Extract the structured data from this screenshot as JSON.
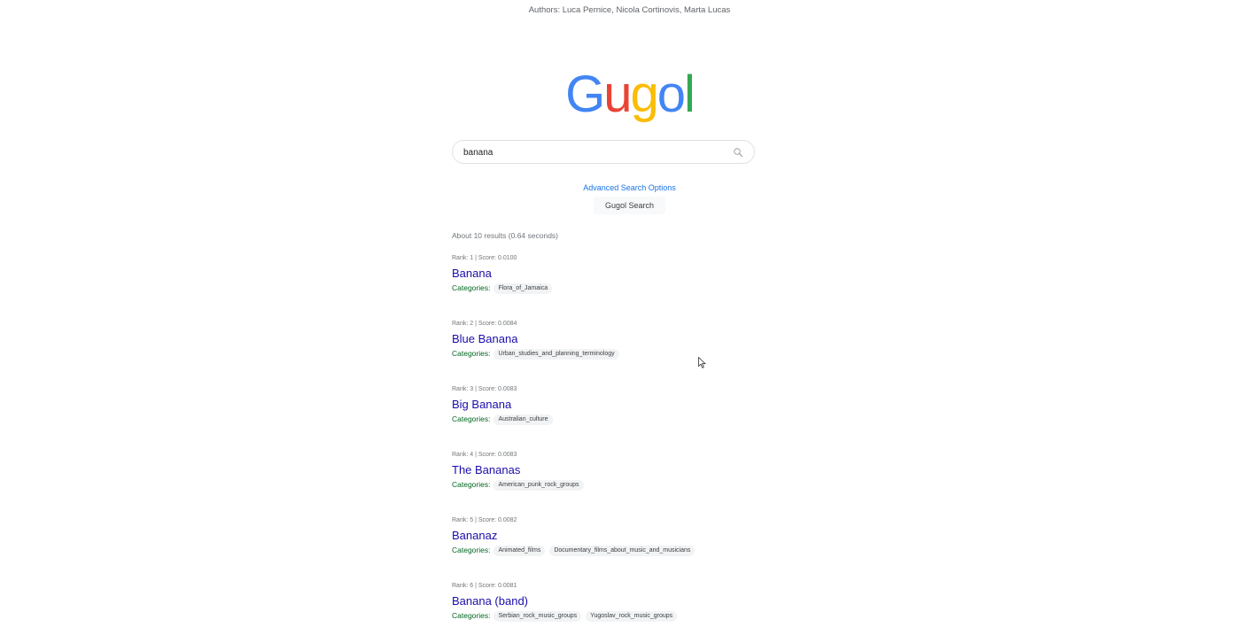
{
  "authors": "Authors: Luca Pernice, Nicola Cortinovis, Marta Lucas",
  "logo": {
    "letters": [
      "G",
      "u",
      "g",
      "o",
      "l"
    ],
    "colors": [
      "#4285F4",
      "#EA4335",
      "#FBBC05",
      "#4285F4",
      "#34A853"
    ]
  },
  "search": {
    "value": "banana",
    "icon": "search-icon"
  },
  "advanced_link": "Advanced Search Options",
  "search_button": "Gugol Search",
  "stats": "About 10 results (0.64 seconds)",
  "categories_label": "Categories:",
  "results": [
    {
      "meta": "Rank: 1 | Score: 0.0100",
      "title": "Banana",
      "categories": [
        "Flora_of_Jamaica"
      ]
    },
    {
      "meta": "Rank: 2 | Score: 0.0084",
      "title": "Blue Banana",
      "categories": [
        "Urban_studies_and_planning_terminology"
      ]
    },
    {
      "meta": "Rank: 3 | Score: 0.0083",
      "title": "Big Banana",
      "categories": [
        "Australian_culture"
      ]
    },
    {
      "meta": "Rank: 4 | Score: 0.0083",
      "title": "The Bananas",
      "categories": [
        "American_punk_rock_groups"
      ]
    },
    {
      "meta": "Rank: 5 | Score: 0.0082",
      "title": "Bananaz",
      "categories": [
        "Animated_films",
        "Documentary_films_about_music_and_musicians"
      ]
    },
    {
      "meta": "Rank: 6 | Score: 0.0081",
      "title": "Banana (band)",
      "categories": [
        "Serbian_rock_music_groups",
        "Yugoslav_rock_music_groups"
      ]
    }
  ]
}
